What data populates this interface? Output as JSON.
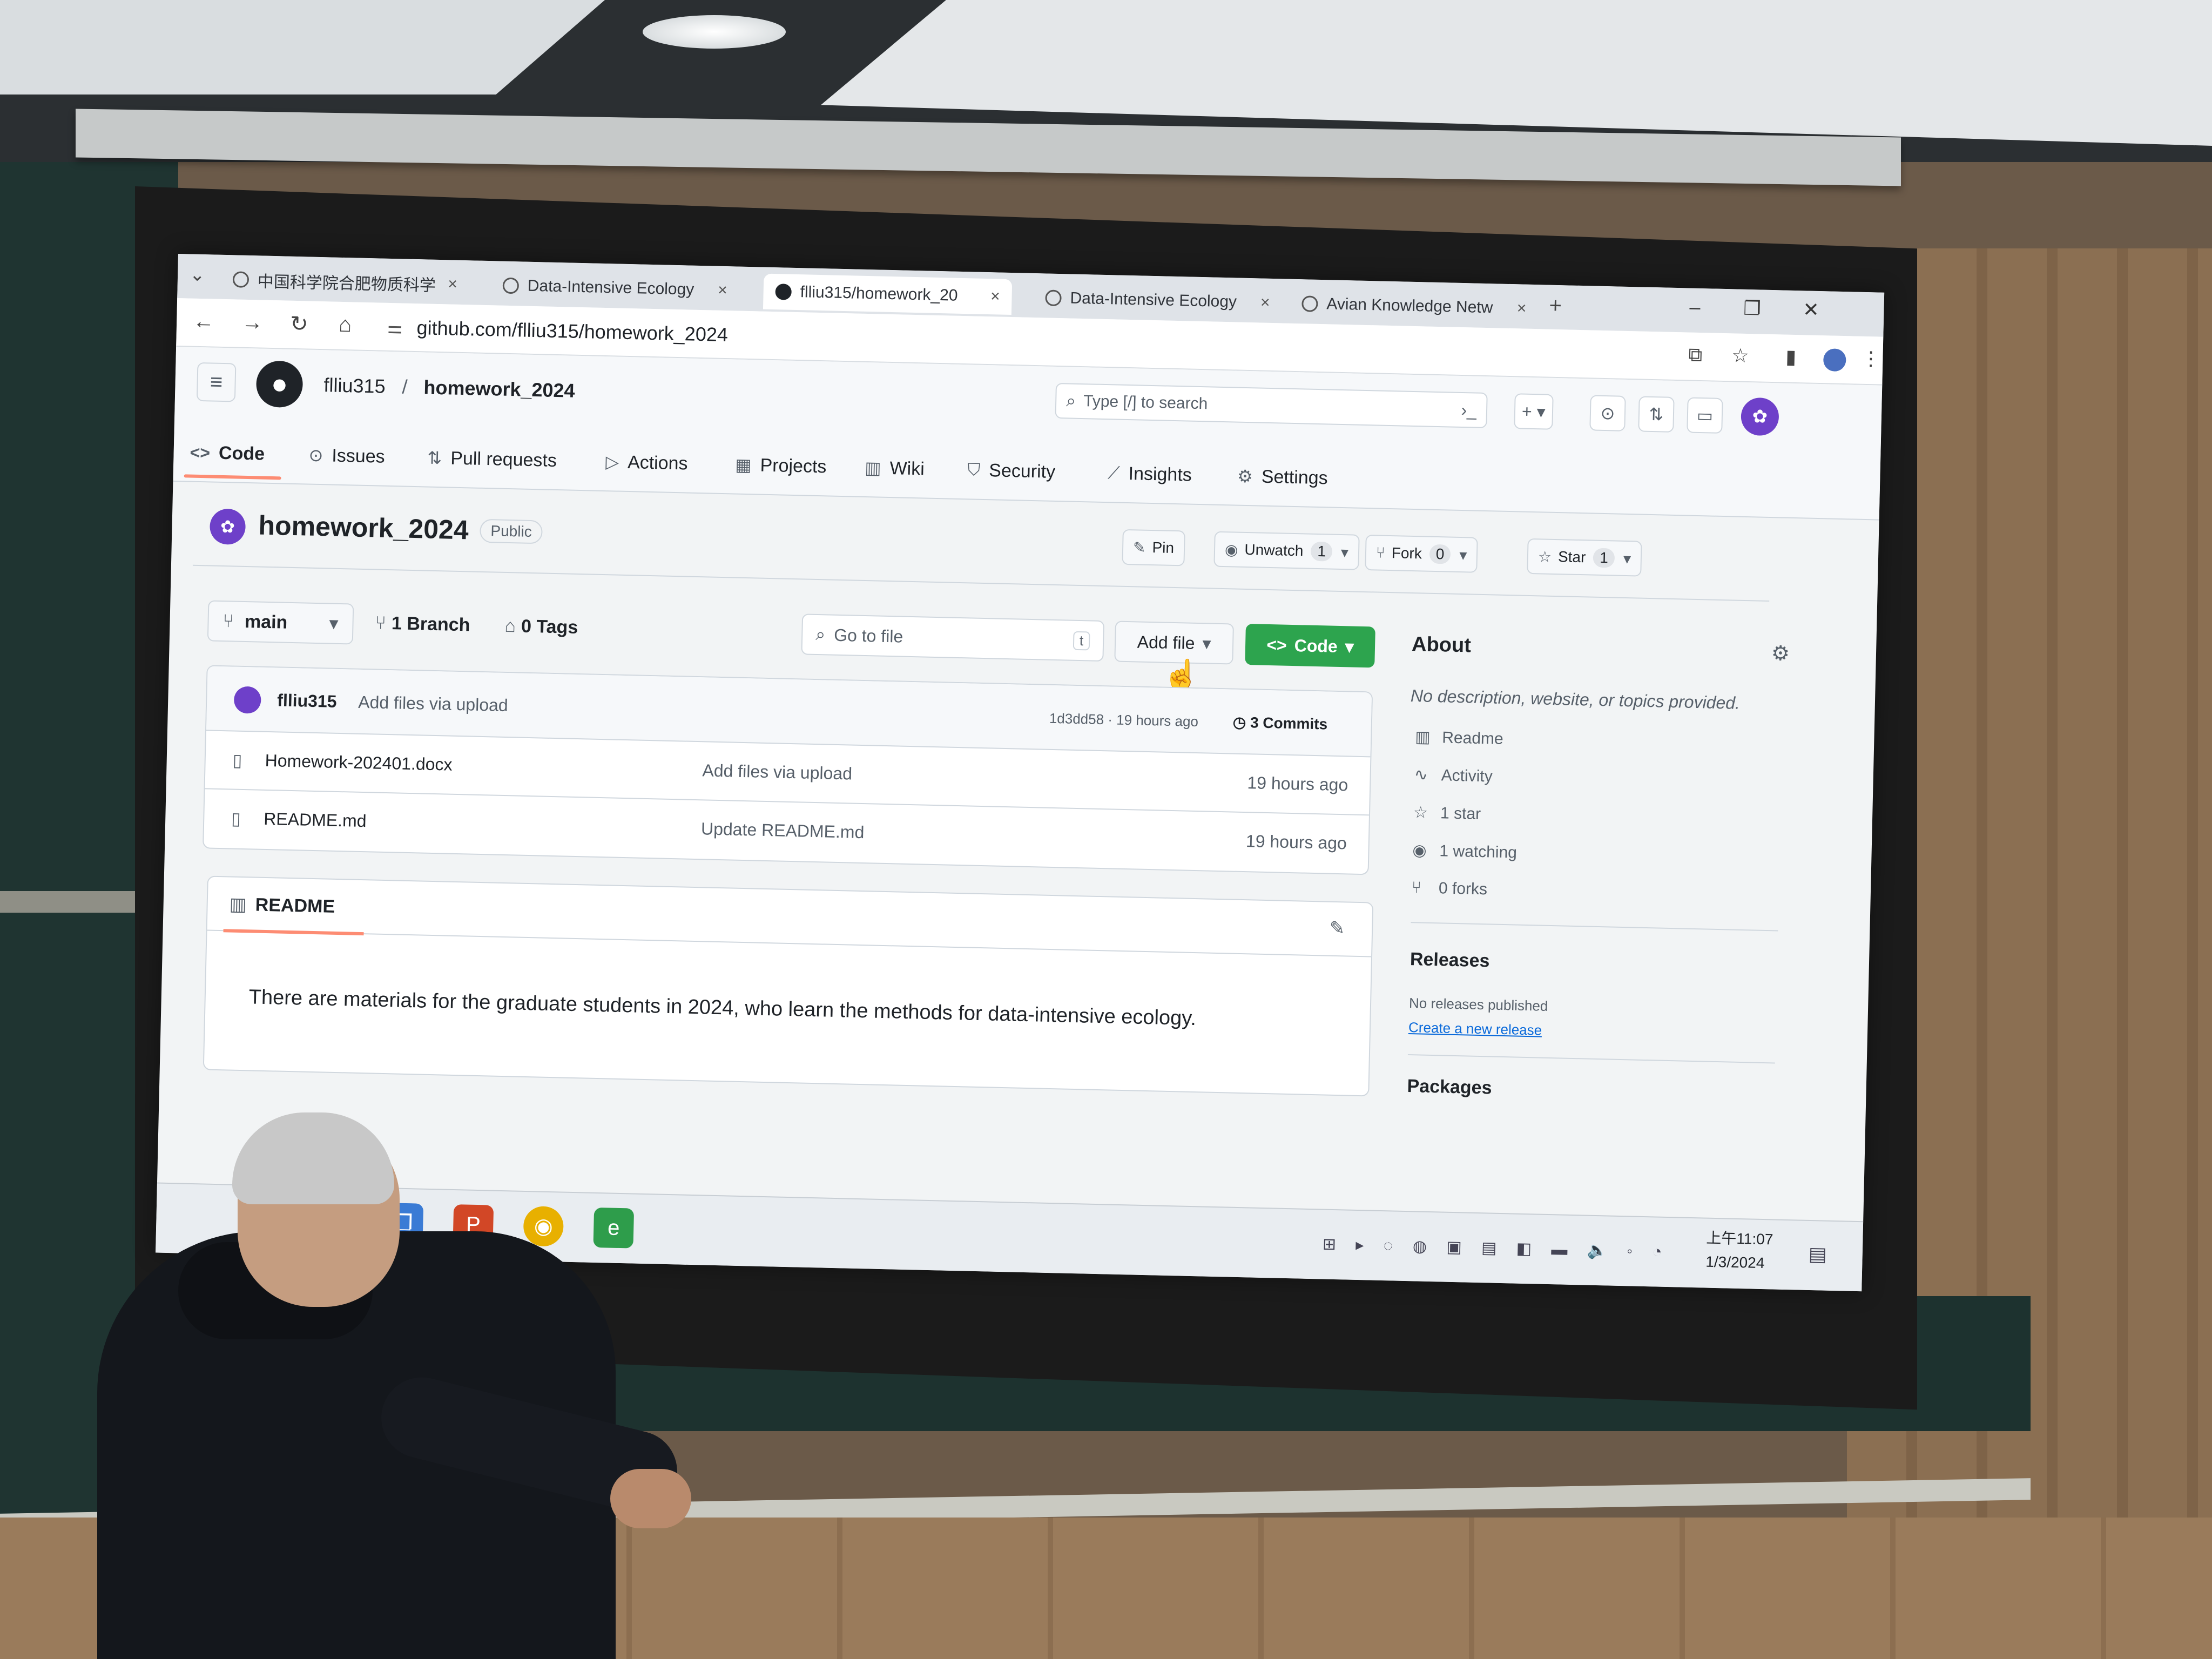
{
  "browser": {
    "tabs": [
      {
        "label": "中国科学院合肥物质科学",
        "active": false
      },
      {
        "label": "Data-Intensive Ecology",
        "active": false
      },
      {
        "label": "flliu315/homework_20",
        "active": true
      },
      {
        "label": "Data-Intensive Ecology",
        "active": false
      },
      {
        "label": "Avian Knowledge Netw",
        "active": false
      }
    ],
    "tab_close": "×",
    "new_tab": "+",
    "url": "github.com/flliu315/homework_2024"
  },
  "header": {
    "owner": "flliu315",
    "separator": "/",
    "repo": "homework_2024",
    "search_placeholder": "Type [/] to search"
  },
  "repo_nav": [
    "Code",
    "Issues",
    "Pull requests",
    "Actions",
    "Projects",
    "Wiki",
    "Security",
    "Insights",
    "Settings"
  ],
  "repo": {
    "title": "homework_2024",
    "visibility": "Public",
    "pin_label": "Pin",
    "unwatch_label": "Unwatch",
    "unwatch_count": "1",
    "fork_label": "Fork",
    "fork_count": "0",
    "star_label": "Star",
    "star_count": "1"
  },
  "toolbar": {
    "branch": "main",
    "branches": "1 Branch",
    "tags": "0 Tags",
    "goto_placeholder": "Go to file",
    "goto_key": "t",
    "add_file": "Add file",
    "code": "Code"
  },
  "latest_commit": {
    "author": "flliu315",
    "message": "Add files via upload",
    "meta": "1d3dd58 · 19 hours ago",
    "commits": "3 Commits"
  },
  "files": [
    {
      "name": "Homework-202401.docx",
      "message": "Add files via upload",
      "time": "19 hours ago"
    },
    {
      "name": "README.md",
      "message": "Update README.md",
      "time": "19 hours ago"
    }
  ],
  "readme": {
    "tab": "README",
    "text": "There are materials for the graduate students in 2024, who learn the methods for data-intensive ecology."
  },
  "about": {
    "title": "About",
    "description": "No description, website, or topics provided.",
    "items": [
      "Readme",
      "Activity",
      "1 star",
      "1 watching",
      "0 forks"
    ],
    "releases_title": "Releases",
    "releases_note": "No releases published",
    "releases_link": "Create a new release",
    "packages_title": "Packages"
  },
  "taskbar": {
    "time": "上午11:07",
    "date": "1/3/2024"
  },
  "colors": {
    "code_button": "#2da44e",
    "tab_underline": "#fd8c73",
    "avatar": "#6e40c9"
  }
}
